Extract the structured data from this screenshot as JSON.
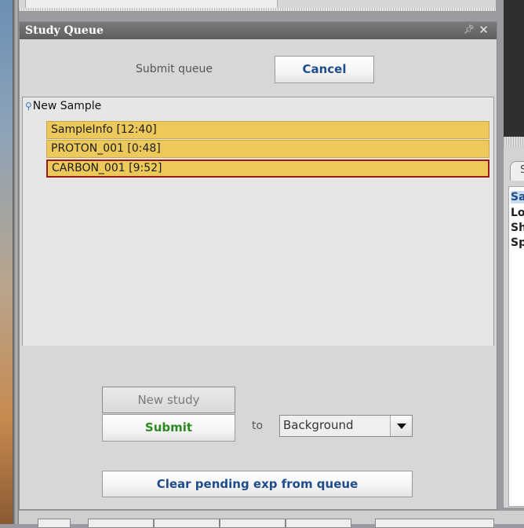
{
  "panel": {
    "title": "Study Queue",
    "pin_icon": "pin-icon",
    "close_icon": "close-icon"
  },
  "queue_controls": {
    "submit_queue_label": "Submit queue",
    "cancel_label": "Cancel"
  },
  "tree": {
    "root_label": "New Sample",
    "items": [
      {
        "label": "SampleInfo [12:40]",
        "selected": false
      },
      {
        "label": "PROTON_001 [0:48]",
        "selected": false
      },
      {
        "label": "CARBON_001 [9:52]",
        "selected": true
      }
    ]
  },
  "actions": {
    "new_study_label": "New study",
    "submit_label": "Submit",
    "to_label": "to",
    "target_select": {
      "value": "Background"
    },
    "clear_label": "Clear pending exp from queue"
  },
  "right_panel": {
    "tab_fragment": "S",
    "lines": [
      "Sa",
      "Lo",
      "Sh",
      "Sp"
    ]
  },
  "colors": {
    "queue_item_bg": "#ecc95a",
    "selected_border": "#9a1a1a",
    "submit_text": "#2a8a1f",
    "button_text_blue": "#1f4c8a"
  }
}
